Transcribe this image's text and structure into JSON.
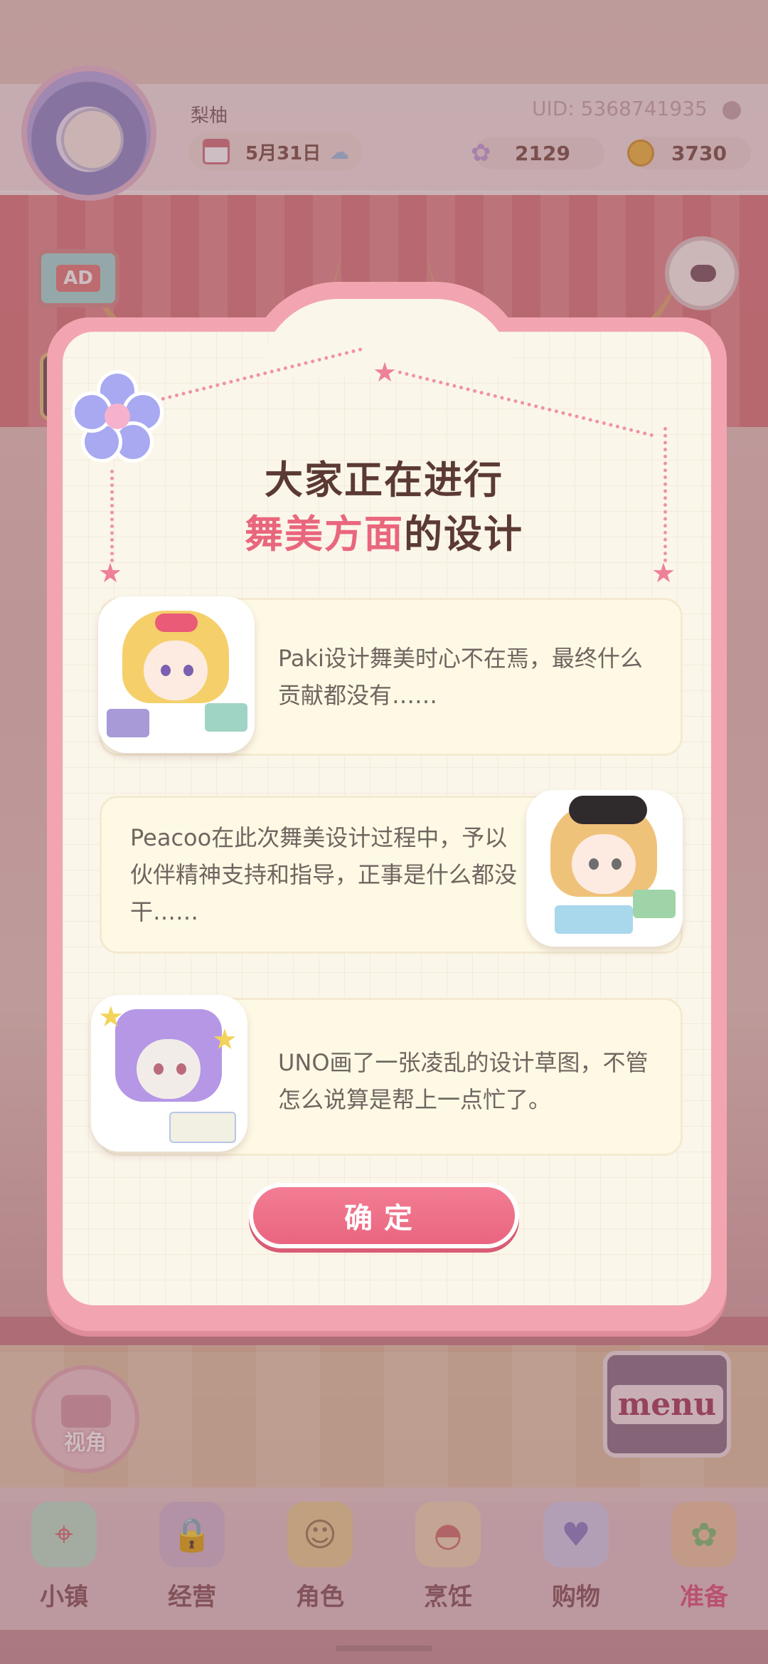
{
  "header": {
    "username": "梨柚",
    "date": "5月31日",
    "uid": "UID: 5368741935",
    "gems": "2129",
    "coins": "3730"
  },
  "side": {
    "ad_label": "AD",
    "camera_label": "视角",
    "menu_label": "menu"
  },
  "dialog": {
    "title_line1": "大家正在进行",
    "title_highlight": "舞美方面",
    "title_suffix": "的设计",
    "cards": [
      {
        "text": "Paki设计舞美时心不在焉，最终什么贡献都没有……"
      },
      {
        "text": "Peacoo在此次舞美设计过程中，予以伙伴精神支持和指导，正事是什么都没干……"
      },
      {
        "text": "UNO画了一张凌乱的设计草图，不管怎么说算是帮上一点忙了。"
      }
    ],
    "confirm_label": "确定"
  },
  "bottom_nav": [
    {
      "label": "小镇",
      "icon": "map-icon"
    },
    {
      "label": "经营",
      "icon": "shopping-bag-lock-icon"
    },
    {
      "label": "角色",
      "icon": "character-icon"
    },
    {
      "label": "烹饪",
      "icon": "sandwich-icon"
    },
    {
      "label": "购物",
      "icon": "shopping-bag-icon"
    },
    {
      "label": "准备",
      "icon": "basket-icon",
      "active": true
    }
  ],
  "colors": {
    "accent": "#e9667d",
    "dialog_border": "#f2a5b1",
    "dialog_bg": "#fbf6ea"
  }
}
